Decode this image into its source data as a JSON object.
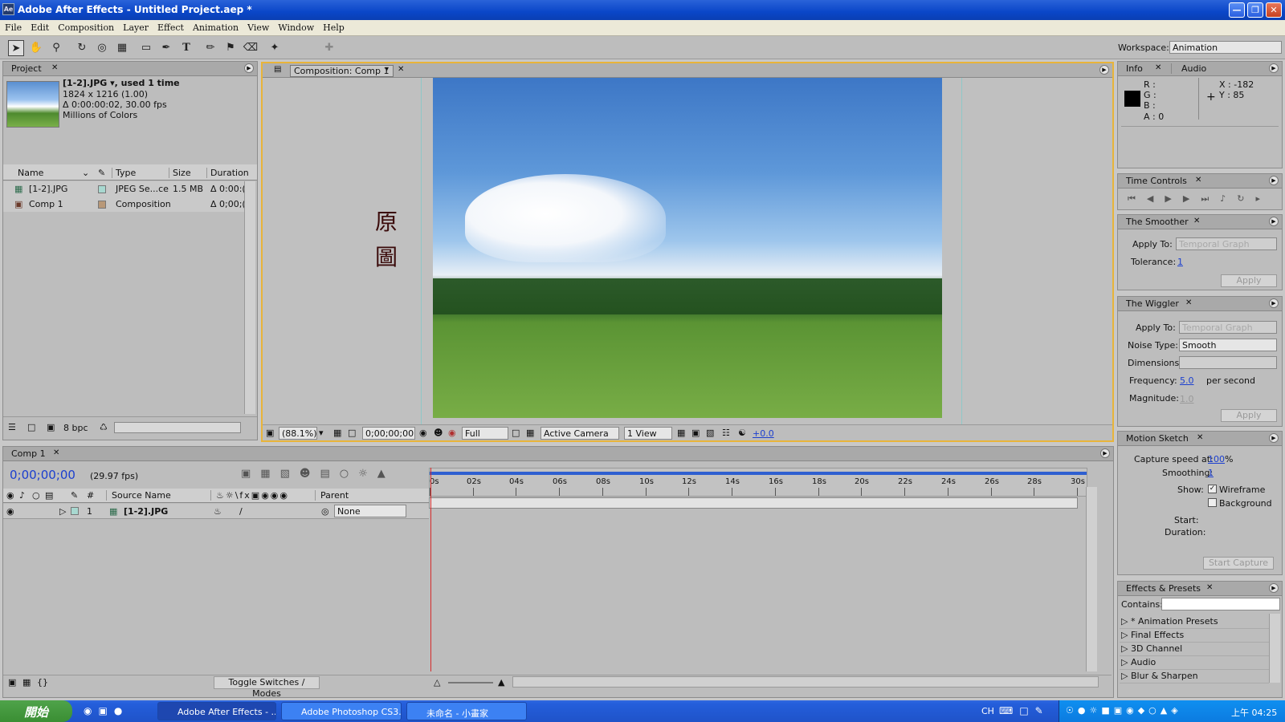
{
  "titlebar": {
    "app_icon": "Ae",
    "title": "Adobe After Effects - Untitled Project.aep *"
  },
  "menu": [
    "File",
    "Edit",
    "Composition",
    "Layer",
    "Effect",
    "Animation",
    "View",
    "Window",
    "Help"
  ],
  "workspace": {
    "label": "Workspace:",
    "value": "Animation"
  },
  "project": {
    "tab": "Project",
    "asset_name": "[1-2].JPG ▾, used 1 time",
    "asset_dims": "1824 x 1216 (1.00)",
    "asset_duration": "Δ 0:00:00:02, 30.00 fps",
    "asset_colors": "Millions of Colors",
    "columns": [
      "Name",
      "Type",
      "Size",
      "Duration"
    ],
    "rows": [
      {
        "name": "[1-2].JPG",
        "type": "JPEG Se...ce",
        "size": "1.5 MB",
        "duration": "Δ 0:00:(",
        "swatch": "#a8d8d0"
      },
      {
        "name": "Comp 1",
        "type": "Composition",
        "size": "",
        "duration": "Δ 0;00;(",
        "swatch": "#b89878"
      }
    ],
    "bpc": "8 bpc"
  },
  "composition": {
    "tab": "Composition: Comp 1",
    "overlay_text_1": "原",
    "overlay_text_2": "圖",
    "zoom": "(88.1%)",
    "timecode": "0;00;00;00",
    "resolution": "Full",
    "camera": "Active Camera",
    "views": "1 View",
    "exposure": "+0.0"
  },
  "info": {
    "tabs": [
      "Info",
      "Audio"
    ],
    "r": "R :",
    "g": "G :",
    "b": "B :",
    "a": "A : 0",
    "x": "X : -182",
    "y": "Y : 85"
  },
  "time_controls": {
    "tab": "Time Controls"
  },
  "smoother": {
    "tab": "The Smoother",
    "apply_to_label": "Apply To:",
    "apply_to_value": "Temporal Graph",
    "tolerance_label": "Tolerance:",
    "tolerance_value": "1",
    "apply_button": "Apply"
  },
  "wiggler": {
    "tab": "The Wiggler",
    "apply_to_label": "Apply To:",
    "apply_to_value": "Temporal Graph",
    "noise_label": "Noise Type:",
    "noise_value": "Smooth",
    "dims_label": "Dimensions:",
    "freq_label": "Frequency:",
    "freq_value": "5.0",
    "freq_unit": "per second",
    "mag_label": "Magnitude:",
    "mag_value": "1.0",
    "apply_button": "Apply"
  },
  "motion_sketch": {
    "tab": "Motion Sketch",
    "speed_label": "Capture speed at:",
    "speed_value": "100",
    "speed_unit": "%",
    "smoothing_label": "Smoothing:",
    "smoothing_value": "1",
    "show_label": "Show:",
    "wireframe": "Wireframe",
    "background": "Background",
    "start_label": "Start:",
    "duration_label": "Duration:",
    "capture_button": "Start Capture"
  },
  "effects": {
    "tab": "Effects & Presets",
    "contains_label": "Contains:",
    "items": [
      "* Animation Presets",
      "Final Effects",
      "3D Channel",
      "Audio",
      "Blur & Sharpen"
    ]
  },
  "timeline": {
    "tab": "Comp 1",
    "timecode": "0;00;00;00",
    "fps": "(29.97 fps)",
    "hash": "#",
    "source_name_col": "Source Name",
    "parent_col": "Parent",
    "layer": {
      "index": "1",
      "name": "[1-2].JPG",
      "parent": "None"
    },
    "ruler": [
      "0s",
      "02s",
      "04s",
      "06s",
      "08s",
      "10s",
      "12s",
      "14s",
      "16s",
      "18s",
      "20s",
      "22s",
      "24s",
      "26s",
      "28s",
      "30s"
    ],
    "toggle_button": "Toggle Switches / Modes"
  },
  "taskbar": {
    "start": "開始",
    "items": [
      "Adobe After Effects - ...",
      "Adobe Photoshop CS3...",
      "未命名 - 小畫家"
    ],
    "lang": "CH",
    "clock": "上午 04:25"
  },
  "colors": {
    "accent_border": "#e8b43a",
    "timecode": "#1b3fcf",
    "playhead": "#d62a2a"
  }
}
